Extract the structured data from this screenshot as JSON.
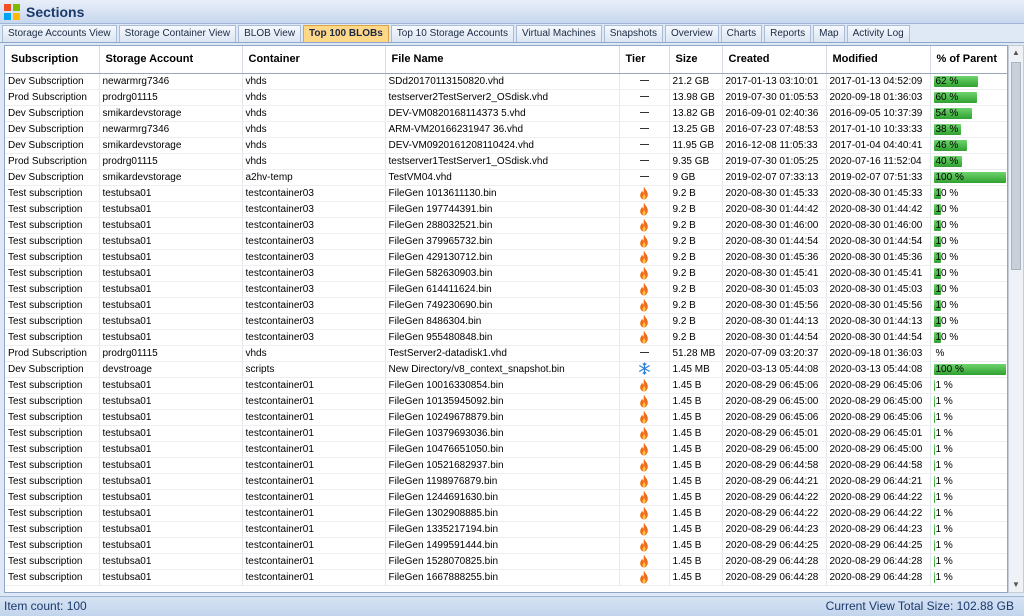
{
  "window": {
    "title": "Sections"
  },
  "colors": {
    "accent": "#ffd789",
    "bar": "#3bb33b",
    "fire": "#f26a1b",
    "snow": "#2f7fd6"
  },
  "tabs": [
    {
      "label": "Storage Accounts View",
      "active": false
    },
    {
      "label": "Storage Container View",
      "active": false
    },
    {
      "label": "BLOB View",
      "active": false
    },
    {
      "label": "Top 100 BLOBs",
      "active": true
    },
    {
      "label": "Top 10 Storage Accounts",
      "active": false
    },
    {
      "label": "Virtual Machines",
      "active": false
    },
    {
      "label": "Snapshots",
      "active": false
    },
    {
      "label": "Overview",
      "active": false
    },
    {
      "label": "Charts",
      "active": false
    },
    {
      "label": "Reports",
      "active": false
    },
    {
      "label": "Map",
      "active": false
    },
    {
      "label": "Activity Log",
      "active": false
    }
  ],
  "columns": [
    "Subscription",
    "Storage Account",
    "Container",
    "File Name",
    "Tier",
    "Size",
    "Created",
    "Modified",
    "% of Parent"
  ],
  "rows": [
    {
      "sub": "Dev Subscription",
      "acct": "newarmrg7346",
      "cont": "vhds",
      "file": "SDd20170113150820.vhd",
      "tier": "none",
      "size": "21.2 GB",
      "created": "2017-01-13 03:10:01",
      "modified": "2017-01-13 04:52:09",
      "pct": "62 %",
      "pctv": 62
    },
    {
      "sub": "Prod Subscription",
      "acct": "prodrg01115",
      "cont": "vhds",
      "file": "testserver2TestServer2_OSdisk.vhd",
      "tier": "none",
      "size": "13.98 GB",
      "created": "2019-07-30 01:05:53",
      "modified": "2020-09-18 01:36:03",
      "pct": "60 %",
      "pctv": 60
    },
    {
      "sub": "Dev Subscription",
      "acct": "smikardevstorage",
      "cont": "vhds",
      "file": "DEV-VM0820168114373 5.vhd",
      "tier": "none",
      "size": "13.82 GB",
      "created": "2016-09-01 02:40:36",
      "modified": "2016-09-05 10:37:39",
      "pct": "54 %",
      "pctv": 54
    },
    {
      "sub": "Dev Subscription",
      "acct": "newarmrg7346",
      "cont": "vhds",
      "file": "ARM-VM20166231947 36.vhd",
      "tier": "none",
      "size": "13.25 GB",
      "created": "2016-07-23 07:48:53",
      "modified": "2017-01-10 10:33:33",
      "pct": "38 %",
      "pctv": 38
    },
    {
      "sub": "Dev Subscription",
      "acct": "smikardevstorage",
      "cont": "vhds",
      "file": "DEV-VM0920161208110424.vhd",
      "tier": "none",
      "size": "11.95 GB",
      "created": "2016-12-08 11:05:33",
      "modified": "2017-01-04 04:40:41",
      "pct": "46 %",
      "pctv": 46
    },
    {
      "sub": "Prod Subscription",
      "acct": "prodrg01115",
      "cont": "vhds",
      "file": "testserver1TestServer1_OSdisk.vhd",
      "tier": "none",
      "size": "9.35 GB",
      "created": "2019-07-30 01:05:25",
      "modified": "2020-07-16 11:52:04",
      "pct": "40 %",
      "pctv": 40
    },
    {
      "sub": "Dev Subscription",
      "acct": "smikardevstorage",
      "cont": "a2hv-temp",
      "file": "TestVM04.vhd",
      "tier": "none",
      "size": "9 GB",
      "created": "2019-02-07 07:33:13",
      "modified": "2019-02-07 07:51:33",
      "pct": "100 %",
      "pctv": 100
    },
    {
      "sub": "Test subscription",
      "acct": "testubsa01",
      "cont": "testcontainer03",
      "file": "FileGen 1013611130.bin",
      "tier": "hot",
      "size": "9.2 B",
      "created": "2020-08-30 01:45:33",
      "modified": "2020-08-30 01:45:33",
      "pct": "10 %",
      "pctv": 10
    },
    {
      "sub": "Test subscription",
      "acct": "testubsa01",
      "cont": "testcontainer03",
      "file": "FileGen 197744391.bin",
      "tier": "hot",
      "size": "9.2 B",
      "created": "2020-08-30 01:44:42",
      "modified": "2020-08-30 01:44:42",
      "pct": "10 %",
      "pctv": 10
    },
    {
      "sub": "Test subscription",
      "acct": "testubsa01",
      "cont": "testcontainer03",
      "file": "FileGen 288032521.bin",
      "tier": "hot",
      "size": "9.2 B",
      "created": "2020-08-30 01:46:00",
      "modified": "2020-08-30 01:46:00",
      "pct": "10 %",
      "pctv": 10
    },
    {
      "sub": "Test subscription",
      "acct": "testubsa01",
      "cont": "testcontainer03",
      "file": "FileGen 379965732.bin",
      "tier": "hot",
      "size": "9.2 B",
      "created": "2020-08-30 01:44:54",
      "modified": "2020-08-30 01:44:54",
      "pct": "10 %",
      "pctv": 10
    },
    {
      "sub": "Test subscription",
      "acct": "testubsa01",
      "cont": "testcontainer03",
      "file": "FileGen 429130712.bin",
      "tier": "hot",
      "size": "9.2 B",
      "created": "2020-08-30 01:45:36",
      "modified": "2020-08-30 01:45:36",
      "pct": "10 %",
      "pctv": 10
    },
    {
      "sub": "Test subscription",
      "acct": "testubsa01",
      "cont": "testcontainer03",
      "file": "FileGen 582630903.bin",
      "tier": "hot",
      "size": "9.2 B",
      "created": "2020-08-30 01:45:41",
      "modified": "2020-08-30 01:45:41",
      "pct": "10 %",
      "pctv": 10
    },
    {
      "sub": "Test subscription",
      "acct": "testubsa01",
      "cont": "testcontainer03",
      "file": "FileGen 614411624.bin",
      "tier": "hot",
      "size": "9.2 B",
      "created": "2020-08-30 01:45:03",
      "modified": "2020-08-30 01:45:03",
      "pct": "10 %",
      "pctv": 10
    },
    {
      "sub": "Test subscription",
      "acct": "testubsa01",
      "cont": "testcontainer03",
      "file": "FileGen 749230690.bin",
      "tier": "hot",
      "size": "9.2 B",
      "created": "2020-08-30 01:45:56",
      "modified": "2020-08-30 01:45:56",
      "pct": "10 %",
      "pctv": 10
    },
    {
      "sub": "Test subscription",
      "acct": "testubsa01",
      "cont": "testcontainer03",
      "file": "FileGen 8486304.bin",
      "tier": "hot",
      "size": "9.2 B",
      "created": "2020-08-30 01:44:13",
      "modified": "2020-08-30 01:44:13",
      "pct": "10 %",
      "pctv": 10
    },
    {
      "sub": "Test subscription",
      "acct": "testubsa01",
      "cont": "testcontainer03",
      "file": "FileGen 955480848.bin",
      "tier": "hot",
      "size": "9.2 B",
      "created": "2020-08-30 01:44:54",
      "modified": "2020-08-30 01:44:54",
      "pct": "10 %",
      "pctv": 10
    },
    {
      "sub": "Prod Subscription",
      "acct": "prodrg01115",
      "cont": "vhds",
      "file": "TestServer2-datadisk1.vhd",
      "tier": "none",
      "size": "51.28 MB",
      "created": "2020-07-09 03:20:37",
      "modified": "2020-09-18 01:36:03",
      "pct": "%",
      "pctv": 0
    },
    {
      "sub": "Dev Subscription",
      "acct": "devstroage",
      "cont": "scripts",
      "file": "New Directory/v8_context_snapshot.bin",
      "tier": "cool",
      "size": "1.45 MB",
      "created": "2020-03-13 05:44:08",
      "modified": "2020-03-13 05:44:08",
      "pct": "100 %",
      "pctv": 100
    },
    {
      "sub": "Test subscription",
      "acct": "testubsa01",
      "cont": "testcontainer01",
      "file": "FileGen 10016330854.bin",
      "tier": "hot",
      "size": "1.45 B",
      "created": "2020-08-29 06:45:06",
      "modified": "2020-08-29 06:45:06",
      "pct": "1 %",
      "pctv": 1
    },
    {
      "sub": "Test subscription",
      "acct": "testubsa01",
      "cont": "testcontainer01",
      "file": "FileGen 10135945092.bin",
      "tier": "hot",
      "size": "1.45 B",
      "created": "2020-08-29 06:45:00",
      "modified": "2020-08-29 06:45:00",
      "pct": "1 %",
      "pctv": 1
    },
    {
      "sub": "Test subscription",
      "acct": "testubsa01",
      "cont": "testcontainer01",
      "file": "FileGen 10249678879.bin",
      "tier": "hot",
      "size": "1.45 B",
      "created": "2020-08-29 06:45:06",
      "modified": "2020-08-29 06:45:06",
      "pct": "1 %",
      "pctv": 1
    },
    {
      "sub": "Test subscription",
      "acct": "testubsa01",
      "cont": "testcontainer01",
      "file": "FileGen 10379693036.bin",
      "tier": "hot",
      "size": "1.45 B",
      "created": "2020-08-29 06:45:01",
      "modified": "2020-08-29 06:45:01",
      "pct": "1 %",
      "pctv": 1
    },
    {
      "sub": "Test subscription",
      "acct": "testubsa01",
      "cont": "testcontainer01",
      "file": "FileGen 10476651050.bin",
      "tier": "hot",
      "size": "1.45 B",
      "created": "2020-08-29 06:45:00",
      "modified": "2020-08-29 06:45:00",
      "pct": "1 %",
      "pctv": 1
    },
    {
      "sub": "Test subscription",
      "acct": "testubsa01",
      "cont": "testcontainer01",
      "file": "FileGen 10521682937.bin",
      "tier": "hot",
      "size": "1.45 B",
      "created": "2020-08-29 06:44:58",
      "modified": "2020-08-29 06:44:58",
      "pct": "1 %",
      "pctv": 1
    },
    {
      "sub": "Test subscription",
      "acct": "testubsa01",
      "cont": "testcontainer01",
      "file": "FileGen 1198976879.bin",
      "tier": "hot",
      "size": "1.45 B",
      "created": "2020-08-29 06:44:21",
      "modified": "2020-08-29 06:44:21",
      "pct": "1 %",
      "pctv": 1
    },
    {
      "sub": "Test subscription",
      "acct": "testubsa01",
      "cont": "testcontainer01",
      "file": "FileGen 1244691630.bin",
      "tier": "hot",
      "size": "1.45 B",
      "created": "2020-08-29 06:44:22",
      "modified": "2020-08-29 06:44:22",
      "pct": "1 %",
      "pctv": 1
    },
    {
      "sub": "Test subscription",
      "acct": "testubsa01",
      "cont": "testcontainer01",
      "file": "FileGen 1302908885.bin",
      "tier": "hot",
      "size": "1.45 B",
      "created": "2020-08-29 06:44:22",
      "modified": "2020-08-29 06:44:22",
      "pct": "1 %",
      "pctv": 1
    },
    {
      "sub": "Test subscription",
      "acct": "testubsa01",
      "cont": "testcontainer01",
      "file": "FileGen 1335217194.bin",
      "tier": "hot",
      "size": "1.45 B",
      "created": "2020-08-29 06:44:23",
      "modified": "2020-08-29 06:44:23",
      "pct": "1 %",
      "pctv": 1
    },
    {
      "sub": "Test subscription",
      "acct": "testubsa01",
      "cont": "testcontainer01",
      "file": "FileGen 1499591444.bin",
      "tier": "hot",
      "size": "1.45 B",
      "created": "2020-08-29 06:44:25",
      "modified": "2020-08-29 06:44:25",
      "pct": "1 %",
      "pctv": 1
    },
    {
      "sub": "Test subscription",
      "acct": "testubsa01",
      "cont": "testcontainer01",
      "file": "FileGen 1528070825.bin",
      "tier": "hot",
      "size": "1.45 B",
      "created": "2020-08-29 06:44:28",
      "modified": "2020-08-29 06:44:28",
      "pct": "1 %",
      "pctv": 1
    },
    {
      "sub": "Test subscription",
      "acct": "testubsa01",
      "cont": "testcontainer01",
      "file": "FileGen 1667888255.bin",
      "tier": "hot",
      "size": "1.45 B",
      "created": "2020-08-29 06:44:28",
      "modified": "2020-08-29 06:44:28",
      "pct": "1 %",
      "pctv": 1
    }
  ],
  "status": {
    "item_count": "Item count: 100",
    "total_size": "Current View Total Size: 102.88 GB"
  }
}
